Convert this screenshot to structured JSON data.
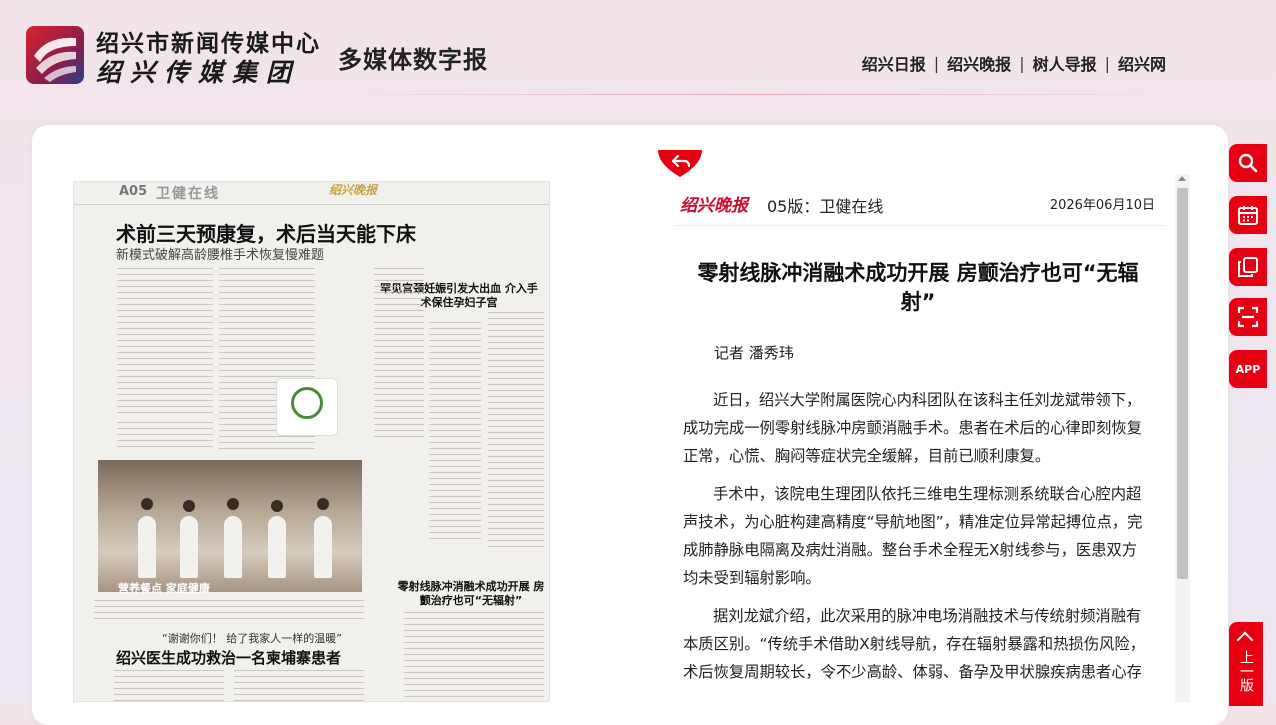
{
  "header": {
    "logo_line1": "绍兴市新闻传媒中心",
    "logo_line2": "绍兴传媒集团",
    "site_title": "多媒体数字报",
    "nav": [
      "绍兴日报",
      "绍兴晚报",
      "树人导报",
      "绍兴网"
    ]
  },
  "newspaper": {
    "section_no": "A05",
    "section_name": "卫健在线",
    "masthead": "绍兴晚报",
    "headline": "术前三天预康复，术后当天能下床",
    "subheadline": "新模式破解高龄腰椎手术恢复慢难题",
    "side_headline": "罕见宫颈妊娠引发大出血 介入手术保住孕妇子宫",
    "photo_caption": "营养餐点  家庭健康",
    "article_headline": "零射线脉冲消融术成功开展 房颤治疗也可“无辐射”",
    "bottom_quote": "“谢谢你们！ 给了我家人一样的温暖”",
    "bottom_headline": "绍兴医生成功救治一名柬埔寨患者"
  },
  "article": {
    "masthead": "绍兴晚报",
    "edition": "05版：卫健在线",
    "date": "2026年06月10日",
    "title": "零射线脉冲消融术成功开展 房颤治疗也可“无辐射”",
    "author": "记者 潘秀玮",
    "paragraphs": [
      "近日，绍兴大学附属医院心内科团队在该科主任刘龙斌带领下，成功完成一例零射线脉冲房颤消融手术。患者在术后的心律即刻恢复正常，心慌、胸闷等症状完全缓解，目前已顺利康复。",
      "手术中，该院电生理团队依托三维电生理标测系统联合心腔内超声技术，为心脏构建高精度“导航地图”，精准定位异常起搏位点，完成肺静脉电隔离及病灶消融。整台手术全程无X射线参与，医患双方均未受到辐射影响。",
      "据刘龙斌介绍，此次采用的脉冲电场消融技术与传统射频消融有本质区别。“传统手术借助X射线导航，存在辐射暴露和热损伤风险，术后恢复周期较长，令不少高龄、体弱、备孕及甲状腺疾病患者心存"
    ]
  },
  "toolbar": {
    "app_label": "APP",
    "to_top": "上一版"
  },
  "colors": {
    "accent": "#e60012",
    "masthead": "#c8102e"
  }
}
